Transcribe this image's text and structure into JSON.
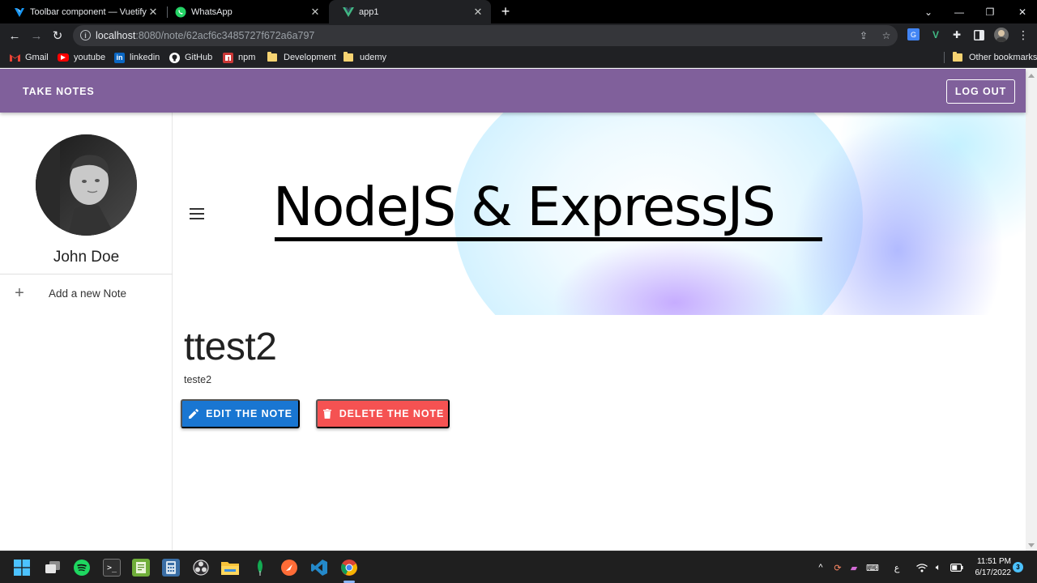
{
  "browser": {
    "tabs": [
      {
        "title": "Toolbar component — Vuetify",
        "icon": "vuetify-icon"
      },
      {
        "title": "WhatsApp",
        "icon": "whatsapp-icon"
      },
      {
        "title": "app1",
        "icon": "vue-icon"
      }
    ],
    "url_host": "localhost",
    "url_path": ":8080/note/62acf6c3485727f672a6a797",
    "bookmarks": [
      {
        "label": "Gmail"
      },
      {
        "label": "youtube"
      },
      {
        "label": "linkedin"
      },
      {
        "label": "GitHub"
      },
      {
        "label": "npm"
      },
      {
        "label": "Development"
      },
      {
        "label": "udemy"
      }
    ],
    "other_bookmarks": "Other bookmarks"
  },
  "app": {
    "title": "TAKE NOTES",
    "logout_label": "LOG OUT",
    "user_name": "John Doe",
    "add_note_label": "Add a new Note",
    "banner_text": "NodeJS & ExpressJS",
    "note": {
      "title": "ttest2",
      "body": "teste2"
    },
    "edit_label": "EDIT THE NOTE",
    "delete_label": "DELETE THE NOTE",
    "colors": {
      "app_bar": "#80609b",
      "edit": "#1976d2",
      "delete": "#f55252"
    }
  },
  "taskbar": {
    "time": "11:51 PM",
    "date": "6/17/2022",
    "notifications": "3",
    "lang": "ع"
  }
}
